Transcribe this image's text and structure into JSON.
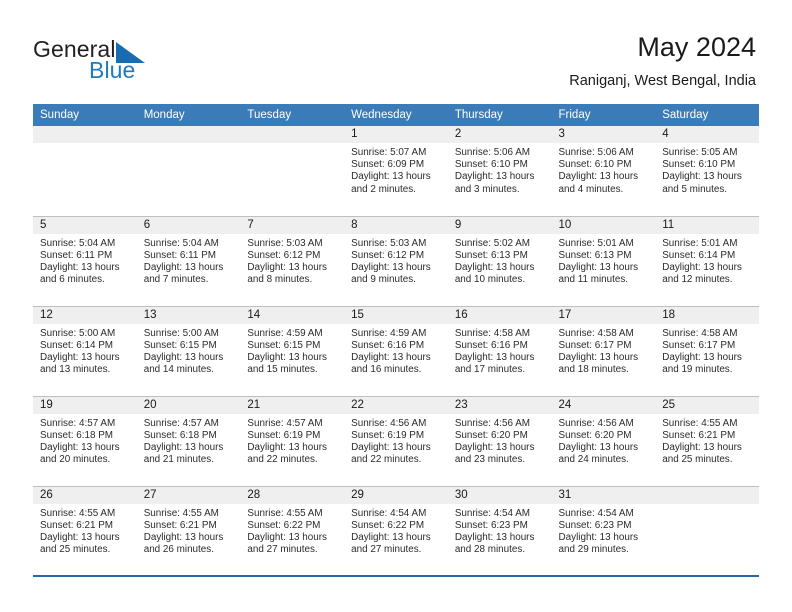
{
  "brand": {
    "name_part1": "General",
    "name_part2": "Blue",
    "triangle_icon": "blue-triangle-icon",
    "color_dark": "#231f20",
    "color_blue": "#1f7bc1"
  },
  "header": {
    "title": "May 2024",
    "subtitle": "Raniganj, West Bengal, India"
  },
  "theme": {
    "header_row_bg": "#3b7cb8",
    "daynum_bg": "#efefef",
    "grid_line": "#bfbfbf",
    "bottom_rule": "#2a66a8"
  },
  "weekday_headers": [
    "Sunday",
    "Monday",
    "Tuesday",
    "Wednesday",
    "Thursday",
    "Friday",
    "Saturday"
  ],
  "labels": {
    "sunrise": "Sunrise:",
    "sunset": "Sunset:",
    "daylight": "Daylight:"
  },
  "weeks": [
    [
      {
        "day": "",
        "empty": true,
        "sunrise": "",
        "sunset": "",
        "daylight_a": "",
        "daylight_b": ""
      },
      {
        "day": "",
        "empty": true,
        "sunrise": "",
        "sunset": "",
        "daylight_a": "",
        "daylight_b": ""
      },
      {
        "day": "",
        "empty": true,
        "sunrise": "",
        "sunset": "",
        "daylight_a": "",
        "daylight_b": ""
      },
      {
        "day": "1",
        "empty": false,
        "sunrise": "Sunrise: 5:07 AM",
        "sunset": "Sunset: 6:09 PM",
        "daylight_a": "Daylight: 13 hours",
        "daylight_b": "and 2 minutes."
      },
      {
        "day": "2",
        "empty": false,
        "sunrise": "Sunrise: 5:06 AM",
        "sunset": "Sunset: 6:10 PM",
        "daylight_a": "Daylight: 13 hours",
        "daylight_b": "and 3 minutes."
      },
      {
        "day": "3",
        "empty": false,
        "sunrise": "Sunrise: 5:06 AM",
        "sunset": "Sunset: 6:10 PM",
        "daylight_a": "Daylight: 13 hours",
        "daylight_b": "and 4 minutes."
      },
      {
        "day": "4",
        "empty": false,
        "sunrise": "Sunrise: 5:05 AM",
        "sunset": "Sunset: 6:10 PM",
        "daylight_a": "Daylight: 13 hours",
        "daylight_b": "and 5 minutes."
      }
    ],
    [
      {
        "day": "5",
        "empty": false,
        "sunrise": "Sunrise: 5:04 AM",
        "sunset": "Sunset: 6:11 PM",
        "daylight_a": "Daylight: 13 hours",
        "daylight_b": "and 6 minutes."
      },
      {
        "day": "6",
        "empty": false,
        "sunrise": "Sunrise: 5:04 AM",
        "sunset": "Sunset: 6:11 PM",
        "daylight_a": "Daylight: 13 hours",
        "daylight_b": "and 7 minutes."
      },
      {
        "day": "7",
        "empty": false,
        "sunrise": "Sunrise: 5:03 AM",
        "sunset": "Sunset: 6:12 PM",
        "daylight_a": "Daylight: 13 hours",
        "daylight_b": "and 8 minutes."
      },
      {
        "day": "8",
        "empty": false,
        "sunrise": "Sunrise: 5:03 AM",
        "sunset": "Sunset: 6:12 PM",
        "daylight_a": "Daylight: 13 hours",
        "daylight_b": "and 9 minutes."
      },
      {
        "day": "9",
        "empty": false,
        "sunrise": "Sunrise: 5:02 AM",
        "sunset": "Sunset: 6:13 PM",
        "daylight_a": "Daylight: 13 hours",
        "daylight_b": "and 10 minutes."
      },
      {
        "day": "10",
        "empty": false,
        "sunrise": "Sunrise: 5:01 AM",
        "sunset": "Sunset: 6:13 PM",
        "daylight_a": "Daylight: 13 hours",
        "daylight_b": "and 11 minutes."
      },
      {
        "day": "11",
        "empty": false,
        "sunrise": "Sunrise: 5:01 AM",
        "sunset": "Sunset: 6:14 PM",
        "daylight_a": "Daylight: 13 hours",
        "daylight_b": "and 12 minutes."
      }
    ],
    [
      {
        "day": "12",
        "empty": false,
        "sunrise": "Sunrise: 5:00 AM",
        "sunset": "Sunset: 6:14 PM",
        "daylight_a": "Daylight: 13 hours",
        "daylight_b": "and 13 minutes."
      },
      {
        "day": "13",
        "empty": false,
        "sunrise": "Sunrise: 5:00 AM",
        "sunset": "Sunset: 6:15 PM",
        "daylight_a": "Daylight: 13 hours",
        "daylight_b": "and 14 minutes."
      },
      {
        "day": "14",
        "empty": false,
        "sunrise": "Sunrise: 4:59 AM",
        "sunset": "Sunset: 6:15 PM",
        "daylight_a": "Daylight: 13 hours",
        "daylight_b": "and 15 minutes."
      },
      {
        "day": "15",
        "empty": false,
        "sunrise": "Sunrise: 4:59 AM",
        "sunset": "Sunset: 6:16 PM",
        "daylight_a": "Daylight: 13 hours",
        "daylight_b": "and 16 minutes."
      },
      {
        "day": "16",
        "empty": false,
        "sunrise": "Sunrise: 4:58 AM",
        "sunset": "Sunset: 6:16 PM",
        "daylight_a": "Daylight: 13 hours",
        "daylight_b": "and 17 minutes."
      },
      {
        "day": "17",
        "empty": false,
        "sunrise": "Sunrise: 4:58 AM",
        "sunset": "Sunset: 6:17 PM",
        "daylight_a": "Daylight: 13 hours",
        "daylight_b": "and 18 minutes."
      },
      {
        "day": "18",
        "empty": false,
        "sunrise": "Sunrise: 4:58 AM",
        "sunset": "Sunset: 6:17 PM",
        "daylight_a": "Daylight: 13 hours",
        "daylight_b": "and 19 minutes."
      }
    ],
    [
      {
        "day": "19",
        "empty": false,
        "sunrise": "Sunrise: 4:57 AM",
        "sunset": "Sunset: 6:18 PM",
        "daylight_a": "Daylight: 13 hours",
        "daylight_b": "and 20 minutes."
      },
      {
        "day": "20",
        "empty": false,
        "sunrise": "Sunrise: 4:57 AM",
        "sunset": "Sunset: 6:18 PM",
        "daylight_a": "Daylight: 13 hours",
        "daylight_b": "and 21 minutes."
      },
      {
        "day": "21",
        "empty": false,
        "sunrise": "Sunrise: 4:57 AM",
        "sunset": "Sunset: 6:19 PM",
        "daylight_a": "Daylight: 13 hours",
        "daylight_b": "and 22 minutes."
      },
      {
        "day": "22",
        "empty": false,
        "sunrise": "Sunrise: 4:56 AM",
        "sunset": "Sunset: 6:19 PM",
        "daylight_a": "Daylight: 13 hours",
        "daylight_b": "and 22 minutes."
      },
      {
        "day": "23",
        "empty": false,
        "sunrise": "Sunrise: 4:56 AM",
        "sunset": "Sunset: 6:20 PM",
        "daylight_a": "Daylight: 13 hours",
        "daylight_b": "and 23 minutes."
      },
      {
        "day": "24",
        "empty": false,
        "sunrise": "Sunrise: 4:56 AM",
        "sunset": "Sunset: 6:20 PM",
        "daylight_a": "Daylight: 13 hours",
        "daylight_b": "and 24 minutes."
      },
      {
        "day": "25",
        "empty": false,
        "sunrise": "Sunrise: 4:55 AM",
        "sunset": "Sunset: 6:21 PM",
        "daylight_a": "Daylight: 13 hours",
        "daylight_b": "and 25 minutes."
      }
    ],
    [
      {
        "day": "26",
        "empty": false,
        "sunrise": "Sunrise: 4:55 AM",
        "sunset": "Sunset: 6:21 PM",
        "daylight_a": "Daylight: 13 hours",
        "daylight_b": "and 25 minutes."
      },
      {
        "day": "27",
        "empty": false,
        "sunrise": "Sunrise: 4:55 AM",
        "sunset": "Sunset: 6:21 PM",
        "daylight_a": "Daylight: 13 hours",
        "daylight_b": "and 26 minutes."
      },
      {
        "day": "28",
        "empty": false,
        "sunrise": "Sunrise: 4:55 AM",
        "sunset": "Sunset: 6:22 PM",
        "daylight_a": "Daylight: 13 hours",
        "daylight_b": "and 27 minutes."
      },
      {
        "day": "29",
        "empty": false,
        "sunrise": "Sunrise: 4:54 AM",
        "sunset": "Sunset: 6:22 PM",
        "daylight_a": "Daylight: 13 hours",
        "daylight_b": "and 27 minutes."
      },
      {
        "day": "30",
        "empty": false,
        "sunrise": "Sunrise: 4:54 AM",
        "sunset": "Sunset: 6:23 PM",
        "daylight_a": "Daylight: 13 hours",
        "daylight_b": "and 28 minutes."
      },
      {
        "day": "31",
        "empty": false,
        "sunrise": "Sunrise: 4:54 AM",
        "sunset": "Sunset: 6:23 PM",
        "daylight_a": "Daylight: 13 hours",
        "daylight_b": "and 29 minutes."
      },
      {
        "day": "",
        "empty": true,
        "sunrise": "",
        "sunset": "",
        "daylight_a": "",
        "daylight_b": ""
      }
    ]
  ]
}
